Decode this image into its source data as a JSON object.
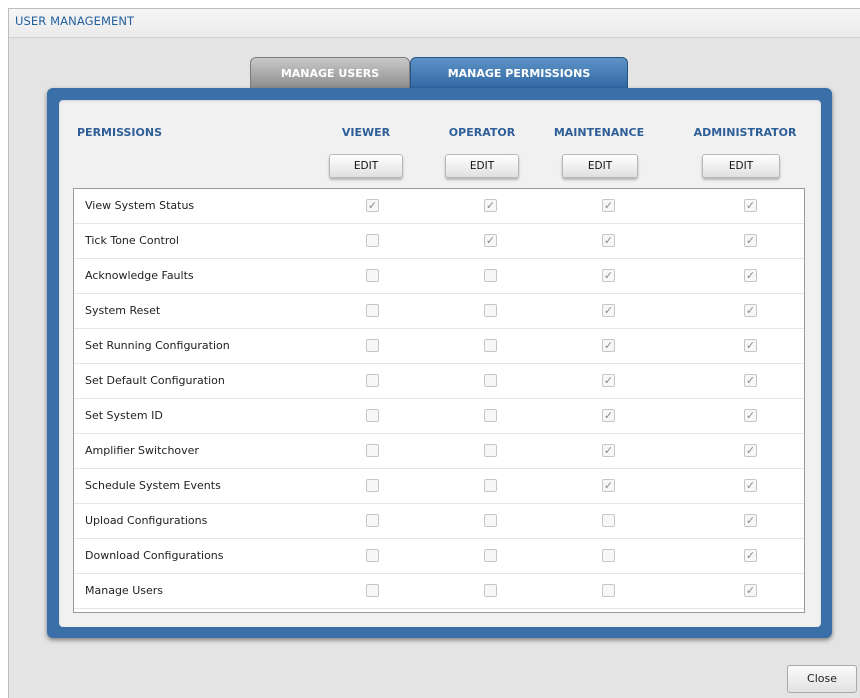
{
  "window": {
    "title": "USER MANAGEMENT"
  },
  "tabs": {
    "manage_users": "MANAGE USERS",
    "manage_permissions": "MANAGE PERMISSIONS",
    "active": "MANAGE PERMISSIONS"
  },
  "table": {
    "permissions_header": "PERMISSIONS",
    "roles": [
      "VIEWER",
      "OPERATOR",
      "MAINTENANCE",
      "ADMINISTRATOR"
    ],
    "edit_label": "EDIT",
    "rows": [
      {
        "label": "View System Status",
        "checked": [
          true,
          true,
          true,
          true
        ]
      },
      {
        "label": "Tick Tone Control",
        "checked": [
          false,
          true,
          true,
          true
        ]
      },
      {
        "label": "Acknowledge Faults",
        "checked": [
          false,
          false,
          true,
          true
        ]
      },
      {
        "label": "System Reset",
        "checked": [
          false,
          false,
          true,
          true
        ]
      },
      {
        "label": "Set Running Configuration",
        "checked": [
          false,
          false,
          true,
          true
        ]
      },
      {
        "label": "Set Default Configuration",
        "checked": [
          false,
          false,
          true,
          true
        ]
      },
      {
        "label": "Set System ID",
        "checked": [
          false,
          false,
          true,
          true
        ]
      },
      {
        "label": "Amplifier Switchover",
        "checked": [
          false,
          false,
          true,
          true
        ]
      },
      {
        "label": "Schedule System Events",
        "checked": [
          false,
          false,
          true,
          true
        ]
      },
      {
        "label": "Upload Configurations",
        "checked": [
          false,
          false,
          false,
          true
        ]
      },
      {
        "label": "Download Configurations",
        "checked": [
          false,
          false,
          false,
          true
        ]
      },
      {
        "label": "Manage Users",
        "checked": [
          false,
          false,
          false,
          true
        ]
      }
    ]
  },
  "footer": {
    "close_label": "Close"
  },
  "colors": {
    "accent": "#3b6fa7",
    "header_text": "#2e5f98",
    "title_text": "#1f5f9e"
  },
  "icons": {
    "checkbox_checked": "checkmark-icon"
  }
}
